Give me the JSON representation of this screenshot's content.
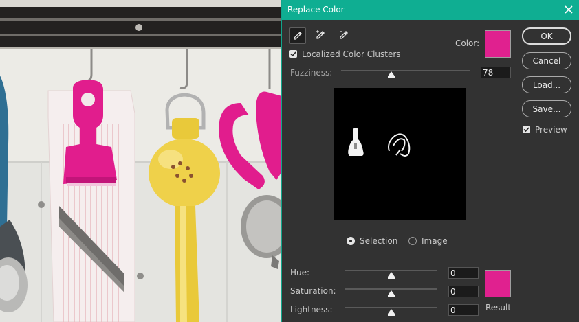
{
  "dialog": {
    "title": "Replace Color",
    "localized_clusters": {
      "label": "Localized Color Clusters",
      "checked": true
    },
    "color_label": "Color:",
    "color_swatch": "#e0218f",
    "fuzziness": {
      "label": "Fuzziness:",
      "value": "78",
      "slider_fraction": 0.39
    },
    "view_mode": {
      "selection_label": "Selection",
      "image_label": "Image",
      "selected": "Selection"
    },
    "buttons": {
      "ok": "OK",
      "cancel": "Cancel",
      "load": "Load...",
      "save": "Save..."
    },
    "preview": {
      "label": "Preview",
      "checked": true
    },
    "replacement": {
      "hue": {
        "label": "Hue:",
        "value": "0"
      },
      "saturation": {
        "label": "Saturation:",
        "value": "0"
      },
      "lightness": {
        "label": "Lightness:",
        "value": "0"
      },
      "result_label": "Result",
      "result_swatch": "#e0218f"
    },
    "tools": [
      "eyedropper-icon",
      "eyedropper-plus-icon",
      "eyedropper-minus-icon"
    ]
  }
}
